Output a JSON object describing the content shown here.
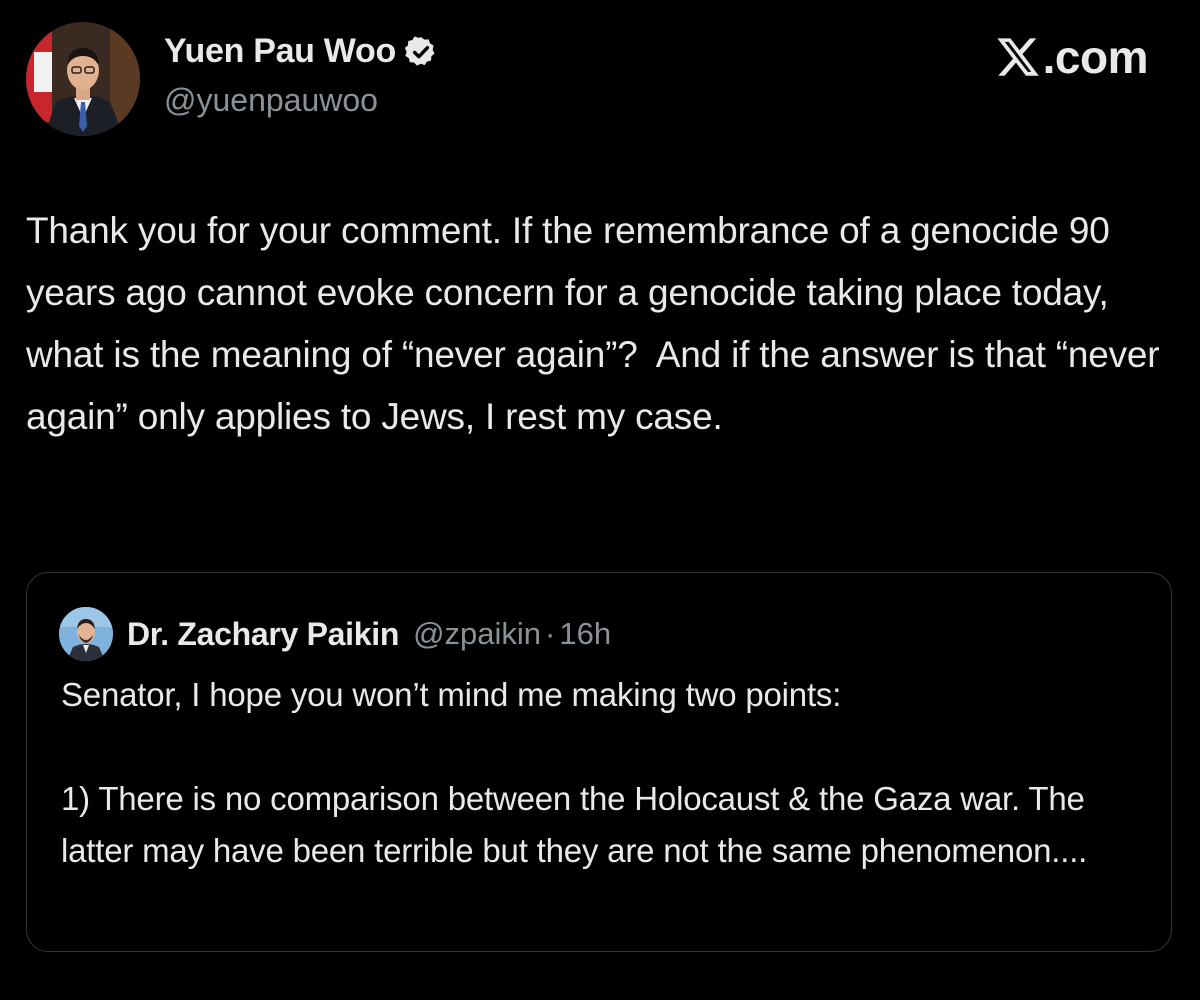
{
  "header": {
    "author_name": "Yuen Pau Woo",
    "author_handle": "@yuenpauwoo",
    "verified_icon": "verified-badge-icon",
    "brand_text": ".com",
    "brand_icon": "x-logo-icon"
  },
  "post": {
    "text": "Thank you for your comment. If the remembrance of a genocide 90 years ago cannot evoke concern for a genocide taking place today, what is the meaning of “never again”?  And if the answer is that “never again” only applies to Jews, I rest my case."
  },
  "quote": {
    "author_name": "Dr. Zachary Paikin",
    "author_handle": "@zpaikin",
    "separator": "·",
    "time": "16h",
    "text": "Senator, I hope you won’t mind me making two points:\n\n1) There is no comparison between the Holocaust & the Gaza war. The latter may have been terrible but they are not the same phenomenon...."
  },
  "colors": {
    "background": "#000000",
    "text": "#e7e9ea",
    "muted": "#8b9198",
    "border": "#33363a",
    "verified": "#e7e9ea"
  }
}
